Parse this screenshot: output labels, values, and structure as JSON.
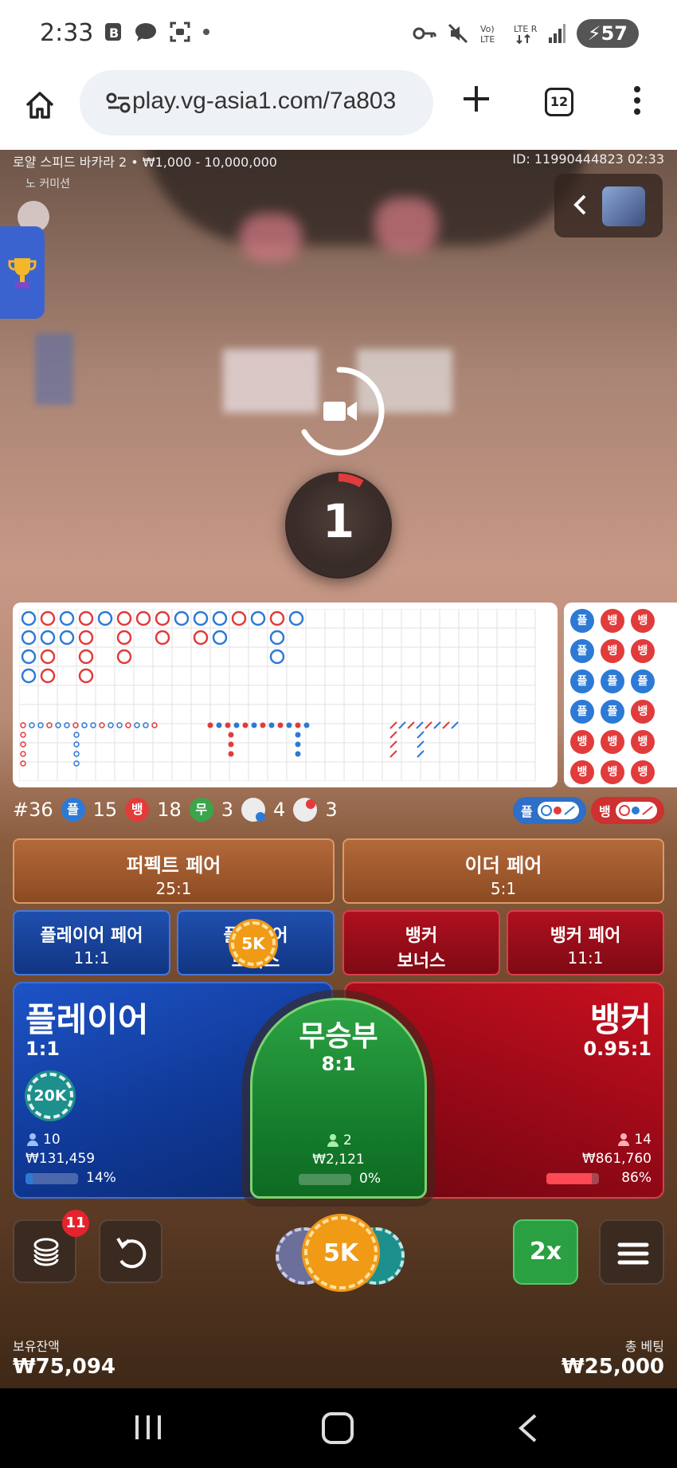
{
  "status_bar": {
    "time": "2:33",
    "left_icons": [
      "b-app-icon",
      "chat-bubble-icon",
      "screenshot-icon",
      "dot-icon"
    ],
    "right_icons": [
      "key-icon",
      "mute-icon",
      "volte-icon",
      "lte-icon",
      "signal-icon"
    ],
    "volte_label": "Vo)\nLTE",
    "lte_label": "LTE R",
    "battery": "57"
  },
  "browser": {
    "url": "play.vg-asia1.com/7a803",
    "tab_count": "12"
  },
  "game": {
    "table_info": "로얄 스피드 바카라 2 • ₩1,000 - 10,000,000",
    "commission_label": "노 커미션",
    "round_id": "ID: 11990444823 02:33",
    "countdown": "1",
    "accent_colors": {
      "player": "#2d7ad6",
      "banker": "#e23b3b",
      "tie": "#3aa64c"
    }
  },
  "beadroad": {
    "columns": [
      [
        "플",
        "플",
        "플",
        "플",
        "뱅",
        "뱅"
      ],
      [
        "뱅",
        "뱅",
        "플",
        "플",
        "뱅",
        "뱅"
      ],
      [
        "뱅",
        "뱅",
        "플",
        "뱅",
        "뱅",
        "뱅"
      ]
    ]
  },
  "stats": {
    "round": "#36",
    "player_letter": "플",
    "player_count": "15",
    "banker_letter": "뱅",
    "banker_count": "18",
    "tie_letter": "무",
    "tie_count": "3",
    "player_pair_count": "4",
    "banker_pair_count": "3",
    "predict_player": "플",
    "predict_banker": "뱅"
  },
  "bets": {
    "perfect_pair": {
      "label": "퍼펙트 페어",
      "odds": "25:1"
    },
    "either_pair": {
      "label": "이더 페어",
      "odds": "5:1"
    },
    "player_pair": {
      "label": "플레이어 페어",
      "odds": "11:1"
    },
    "player_bonus": {
      "label": "플레이어",
      "line2": "보너스"
    },
    "banker_bonus": {
      "label": "뱅커",
      "line2": "보너스"
    },
    "banker_pair": {
      "label": "뱅커 페어",
      "odds": "11:1"
    },
    "player_bonus_chip": "5K",
    "player": {
      "label": "플레이어",
      "odds": "1:1",
      "players": "10",
      "amount": "₩131,459",
      "percent": "14%",
      "percent_value": 14,
      "chip": "20K"
    },
    "tie": {
      "label": "무승부",
      "odds": "8:1",
      "players": "2",
      "amount": "₩2,121",
      "percent": "0%",
      "percent_value": 0
    },
    "banker": {
      "label": "뱅커",
      "odds": "0.95:1",
      "players": "14",
      "amount": "₩861,760",
      "percent": "86%",
      "percent_value": 86
    }
  },
  "controls": {
    "chip_badge": "11",
    "selected_chip": "5K",
    "double_label": "2x"
  },
  "footer": {
    "balance_label": "보유잔액",
    "balance_value": "₩75,094",
    "total_bet_label": "총 베팅",
    "total_bet_value": "₩25,000"
  }
}
